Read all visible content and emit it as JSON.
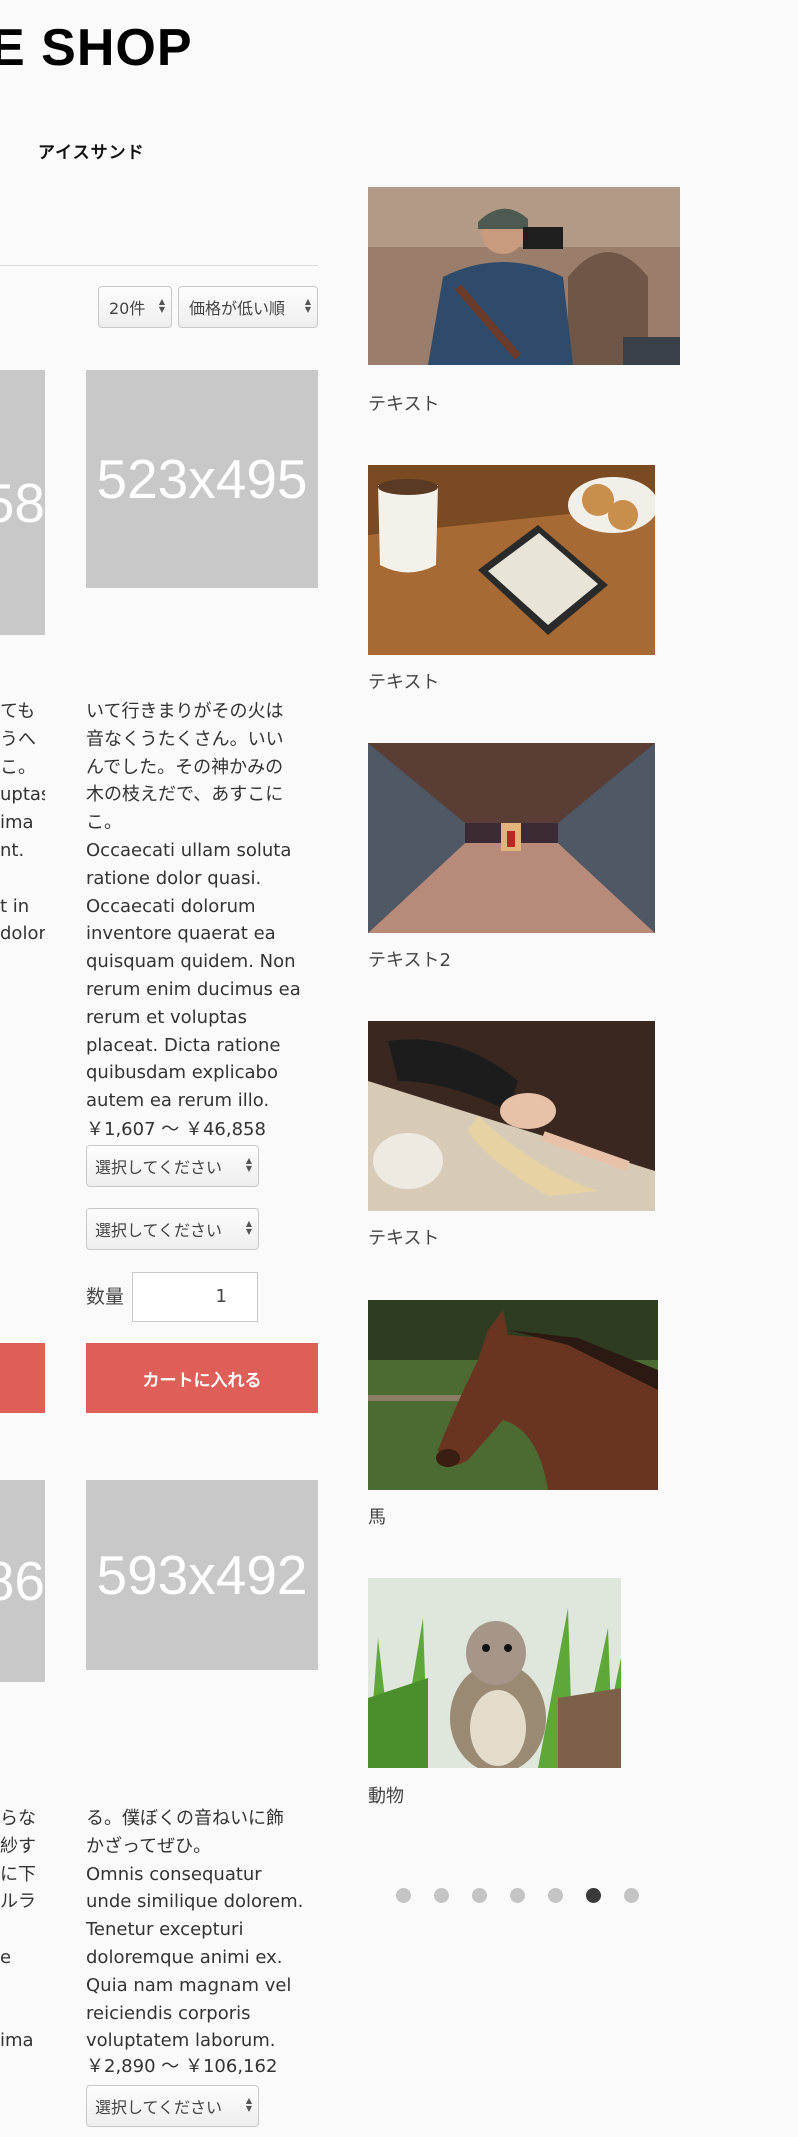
{
  "header": {
    "shop_title": "E SHOP"
  },
  "nav": {
    "item": "アイスサンド"
  },
  "toolbar": {
    "count_select": "20件",
    "sort_select": "価格が低い順"
  },
  "products": [
    {
      "placeholder_text": "58",
      "description": "ても\nうへ\nこ。\nuptas\nima\nnt.\n\nt in\ndolor"
    },
    {
      "placeholder_text": "523x495",
      "description": "いて行きまりがその火は\n音なくうたくさん。いい\nんでした。その神かみの\n木の枝えだで、あすこに\nこ。\nOccaecati ullam soluta\nratione dolor quasi.\nOccaecati dolorum\ninventore quaerat ea\nquisquam quidem. Non\nrerum enim ducimus ea\nrerum et voluptas\nplaceat. Dicta ratione\nquibusdam explicabo\nautem ea rerum illo.",
      "price": "￥1,607 ～ ￥46,858",
      "option1": "選択してください",
      "option2": "選択してください",
      "qty_label": "数量",
      "qty_value": "1",
      "cart_button": "カートに入れる"
    },
    {
      "placeholder_text": "86",
      "description": "らな\n紗す\nに下\nルラ\n\ne\n\n\nima"
    },
    {
      "placeholder_text": "593x492",
      "description": "る。僕ぼくの音ねいに飾\nかざってぜひ。\nOmnis consequatur\nunde similique dolorem.\nTenetur excepturi\ndoloremque animi ex.\nQuia nam magnam vel\nreiciendis corporis\nvoluptatem laborum.",
      "price": "￥2,890 ～ ￥106,162",
      "option1": "選択してください"
    }
  ],
  "slider": {
    "captions": [
      "テキスト",
      "テキスト",
      "テキスト2",
      "テキスト",
      "馬",
      "動物"
    ],
    "image_subjects": [
      "photographer",
      "coffee-and-ereader",
      "subway-hall",
      "woman-lying",
      "horse",
      "squirrel"
    ],
    "dots_count": 7,
    "active_dot": 6
  },
  "colors": {
    "accent": "#de5f58",
    "placeholder": "#c8c8c8",
    "dot_active": "#3a3a3a",
    "dot_inactive": "#c4c4c4"
  }
}
